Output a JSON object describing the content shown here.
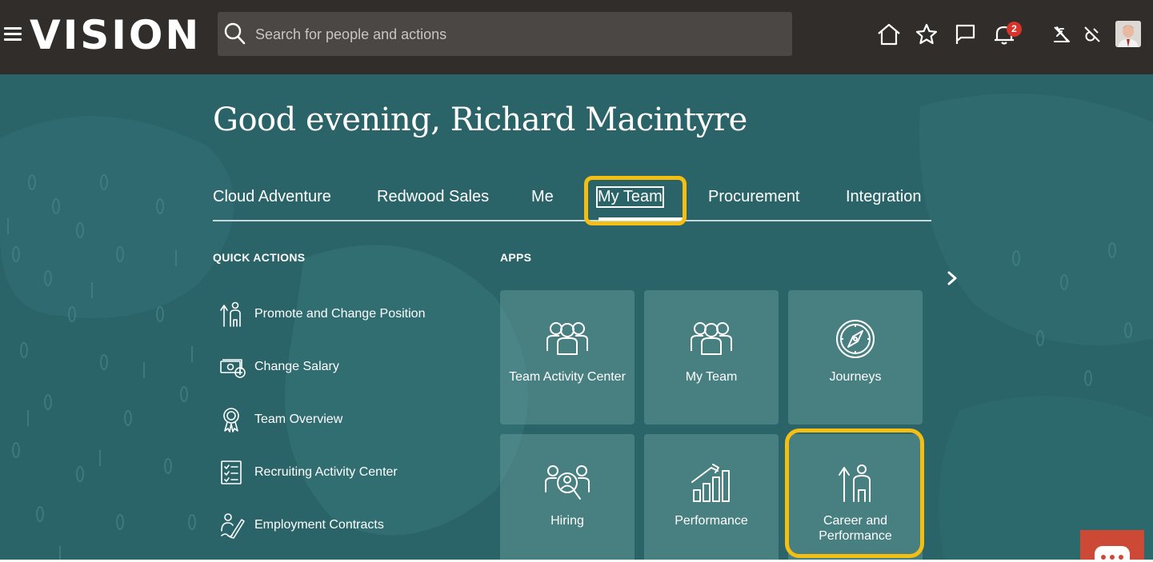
{
  "app": {
    "logo_text": "VISION",
    "search_placeholder": "Search for people and actions",
    "notification_count": "2",
    "icons": {
      "home": "home-icon",
      "favorites": "star-icon",
      "flag": "flag-icon",
      "notifications": "bell-icon",
      "tool1": "unsupported-tool-icon",
      "tool2": "disabled-tool-icon"
    }
  },
  "greeting": "Good evening, Richard Macintyre",
  "tabs": [
    {
      "label": "Cloud Adventure"
    },
    {
      "label": "Redwood Sales"
    },
    {
      "label": "Me"
    },
    {
      "label": "My Team",
      "active": true
    },
    {
      "label": "Procurement"
    },
    {
      "label": "Integration"
    }
  ],
  "quick_actions": {
    "title": "QUICK ACTIONS",
    "items": [
      {
        "label": "Promote and Change Position"
      },
      {
        "label": "Change Salary"
      },
      {
        "label": "Team Overview"
      },
      {
        "label": "Recruiting Activity Center"
      },
      {
        "label": "Employment Contracts"
      }
    ]
  },
  "apps": {
    "title": "APPS",
    "tiles": [
      {
        "label": "Team Activity Center"
      },
      {
        "label": "My Team"
      },
      {
        "label": "Journeys"
      },
      {
        "label": "Hiring"
      },
      {
        "label": "Performance"
      },
      {
        "label": "Career and Performance"
      }
    ]
  },
  "colors": {
    "topbar": "#312d2a",
    "hero": "#2a6468",
    "highlight": "#f4be12",
    "badge": "#d7352b"
  }
}
